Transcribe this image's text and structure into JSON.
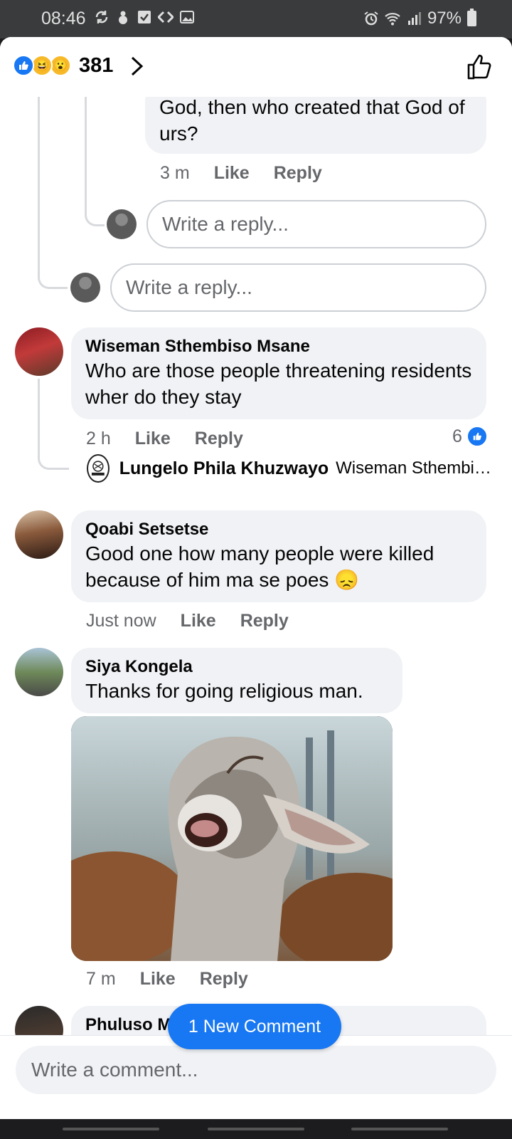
{
  "status_bar": {
    "time": "08:46",
    "battery": "97%",
    "icons": [
      "sync-icon",
      "bug-icon",
      "check-box-icon",
      "code-icon",
      "image-icon",
      "alarm-icon",
      "wifi-icon",
      "signal-icon",
      "battery-icon"
    ]
  },
  "header": {
    "reaction_count": "381",
    "reactions": [
      "like",
      "haha",
      "wow"
    ]
  },
  "comments": {
    "partial": {
      "text": "God, then who created that God of urs?",
      "time": "3 m",
      "like": "Like",
      "reply": "Reply"
    },
    "reply_input_nested": "Write a reply...",
    "reply_input_outer": "Write a reply...",
    "c1": {
      "author": "Wiseman Sthembiso Msane",
      "text": "Who are those people threatening residents wher do they stay",
      "time": "2 h",
      "like": "Like",
      "reply": "Reply",
      "like_count": "6",
      "reply_preview_author": "Lungelo Phila Khuzwayo",
      "reply_preview_text": "Wiseman Sthembiso Msane"
    },
    "c2": {
      "author": "Qoabi Setsetse",
      "text": "Good one how many people were killed because of him ma se poes",
      "emoji": "😞",
      "time": "Just now",
      "like": "Like",
      "reply": "Reply"
    },
    "c3": {
      "author": "Siya Kongela",
      "text": "Thanks for going religious man.",
      "time": "7 m",
      "like": "Like",
      "reply": "Reply"
    },
    "c4": {
      "author": "Phuluso Marwala"
    }
  },
  "new_comment_pill": "1 New Comment",
  "composer": {
    "placeholder": "Write a comment..."
  },
  "colors": {
    "accent": "#1877f2",
    "bubble": "#f0f2f5",
    "meta": "#65676b"
  }
}
